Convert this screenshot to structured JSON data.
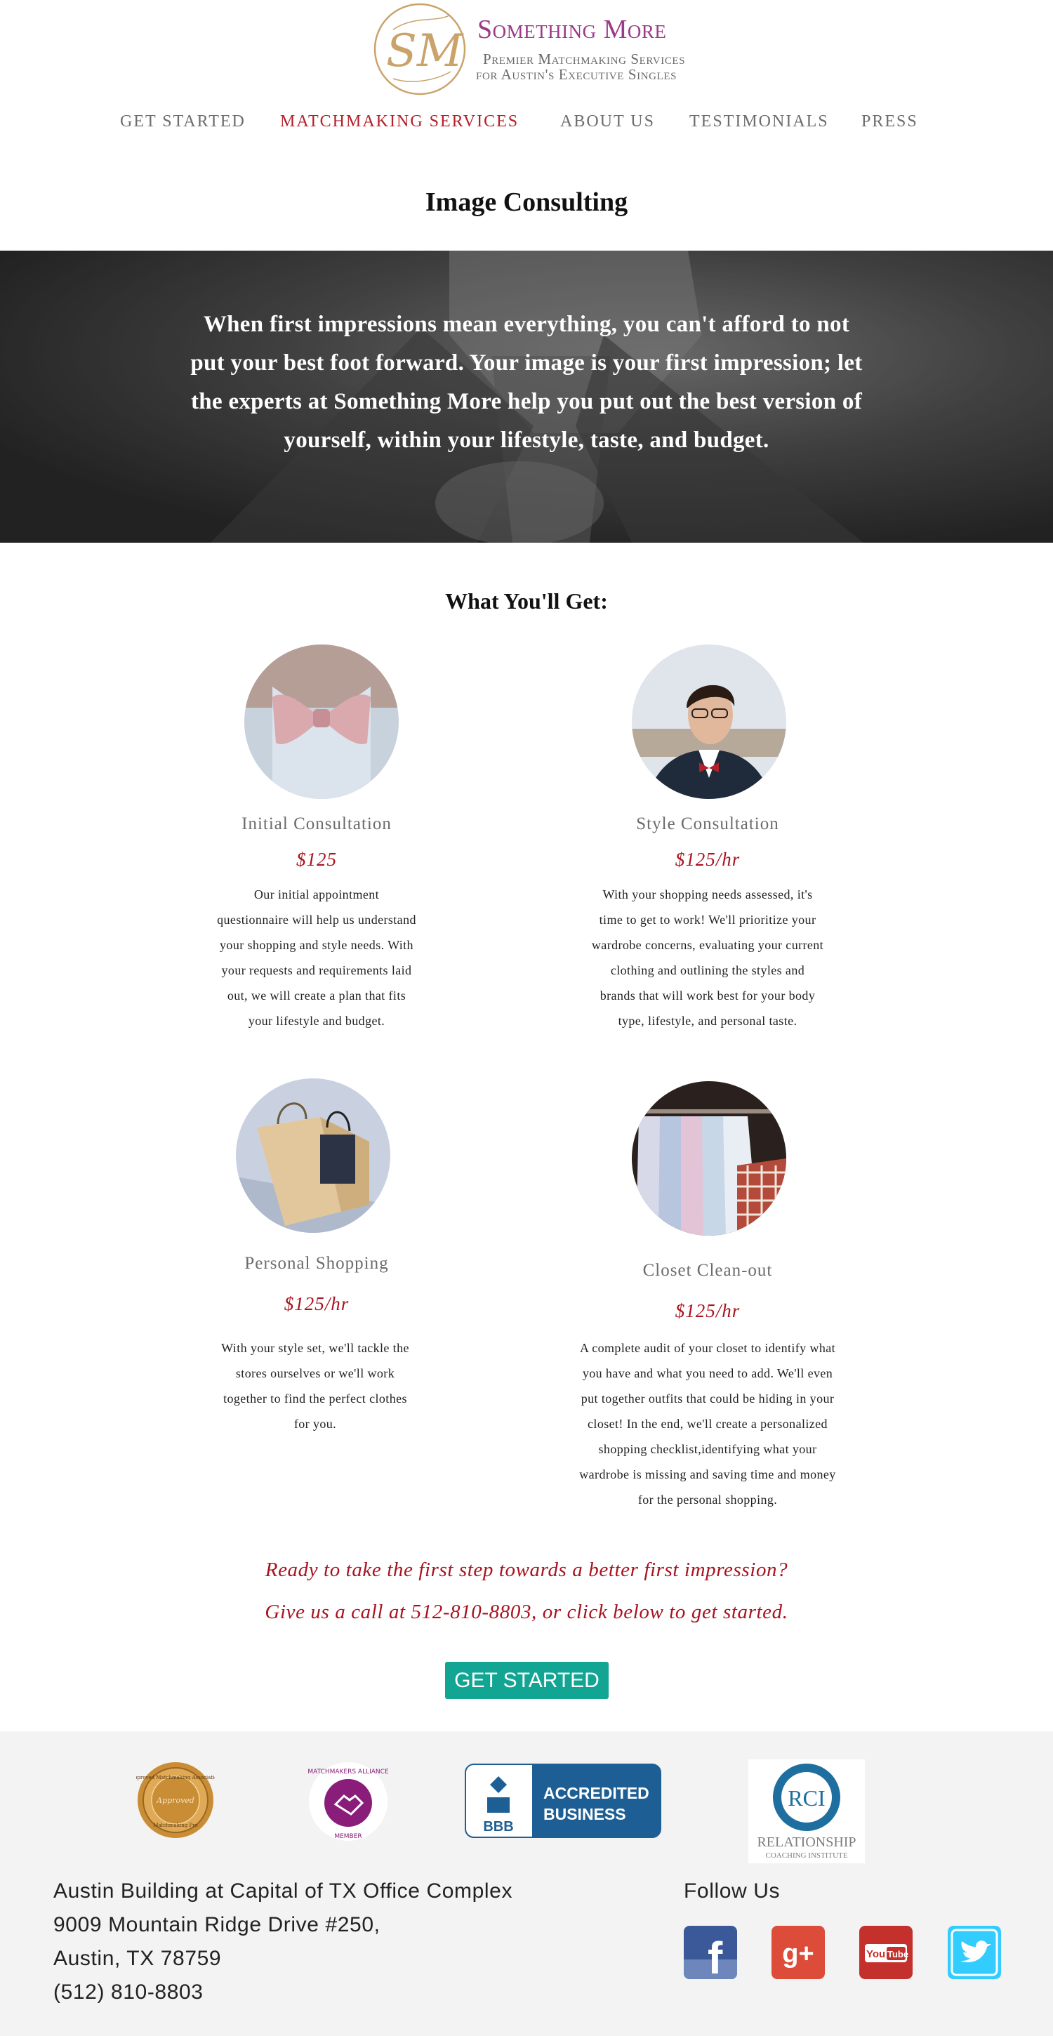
{
  "brand": {
    "monogram": "SM",
    "name": "Something More",
    "tagline_1": "Premier Matchmaking Services",
    "tagline_2": "for Austin's Executive Singles",
    "color_primary": "#9b3a87",
    "color_gold": "#c9a36a"
  },
  "nav": {
    "items": [
      {
        "label": "Get Started"
      },
      {
        "label": "Matchmaking Services",
        "active": true
      },
      {
        "label": "About Us"
      },
      {
        "label": "Testimonials"
      },
      {
        "label": "Press"
      }
    ]
  },
  "page": {
    "title": "Image Consulting"
  },
  "hero": {
    "text": "When first impressions mean everything, you can't afford to not put your best foot forward. Your image is your first impression; let the experts at Something More help you put out the best version of yourself, within your lifestyle, taste, and budget."
  },
  "services": {
    "title": "What You'll Get:",
    "items": [
      {
        "name": "Initial Consultation",
        "price": "$125",
        "image_icon": "bow-tie-photo",
        "description": [
          "Our initial appointment",
          "questionnaire will help us understand",
          "your  shopping and style needs. With",
          "your requests and requirements laid",
          "out, we will create a plan that fits",
          "your lifestyle and budget."
        ]
      },
      {
        "name": "Style Consultation",
        "price": "$125/hr",
        "image_icon": "man-in-suit-photo",
        "description": [
          "With your shopping needs assessed, it's",
          "time to get to work! We'll prioritize your",
          "wardrobe concerns, evaluating your current",
          "clothing and outlining the styles and",
          "brands that will work best for your body",
          "type, lifestyle, and personal taste."
        ]
      },
      {
        "name": "Personal Shopping",
        "price": "$125/hr",
        "image_icon": "shopping-bags-photo",
        "description": [
          "With your style set, we'll tackle the",
          "stores ourselves or we'll work",
          "together to find the perfect clothes",
          "for you."
        ]
      },
      {
        "name": "Closet Clean-out",
        "price": "$125/hr",
        "image_icon": "shirts-rack-photo",
        "description": [
          "A complete audit of your closet to identify what",
          "you have and what you need to add. We'll even",
          "put together outfits that could be hiding in your",
          "closet! In the end, we'll create a personalized",
          "shopping checklist,identifying what your",
          "wardrobe is missing and saving time and money",
          "for the personal shopping."
        ]
      }
    ]
  },
  "cta": {
    "line_1": "Ready to take the first step towards a better first impression?",
    "line_2": "Give us a call at 512-810-8803, or click below to get started.",
    "button": "GET STARTED",
    "button_color": "#12a593"
  },
  "footer": {
    "badges": {
      "seal_top": "Approved Matchmaking Association",
      "seal_mid": "Approved",
      "seal_bottom": "Matchmaking Pro",
      "alliance_top": "MATCHMAKERS ALLIANCE",
      "alliance_bottom": "MEMBER",
      "bbb_logo": "BBB",
      "bbb_line1": "ACCREDITED",
      "bbb_line2": "BUSINESS",
      "rci_logo": "RCI",
      "rci_line1": "RELATIONSHIP",
      "rci_line2": "COACHING INSTITUTE"
    },
    "address": [
      "Austin Building at Capital of TX Office Complex",
      "9009 Mountain Ridge Drive #250,",
      "Austin, TX 78759",
      "(512) 810-8803"
    ],
    "follow_label": "Follow Us",
    "social": [
      {
        "icon": "facebook-icon",
        "glyph": "f",
        "color": "#3b5998"
      },
      {
        "icon": "google-plus-icon",
        "glyph": "g+",
        "color": "#dd4b39"
      },
      {
        "icon": "youtube-icon",
        "glyph_1": "You",
        "glyph_2": "Tube",
        "color": "#c4302b"
      },
      {
        "icon": "twitter-icon",
        "color": "#33ccff"
      }
    ]
  }
}
